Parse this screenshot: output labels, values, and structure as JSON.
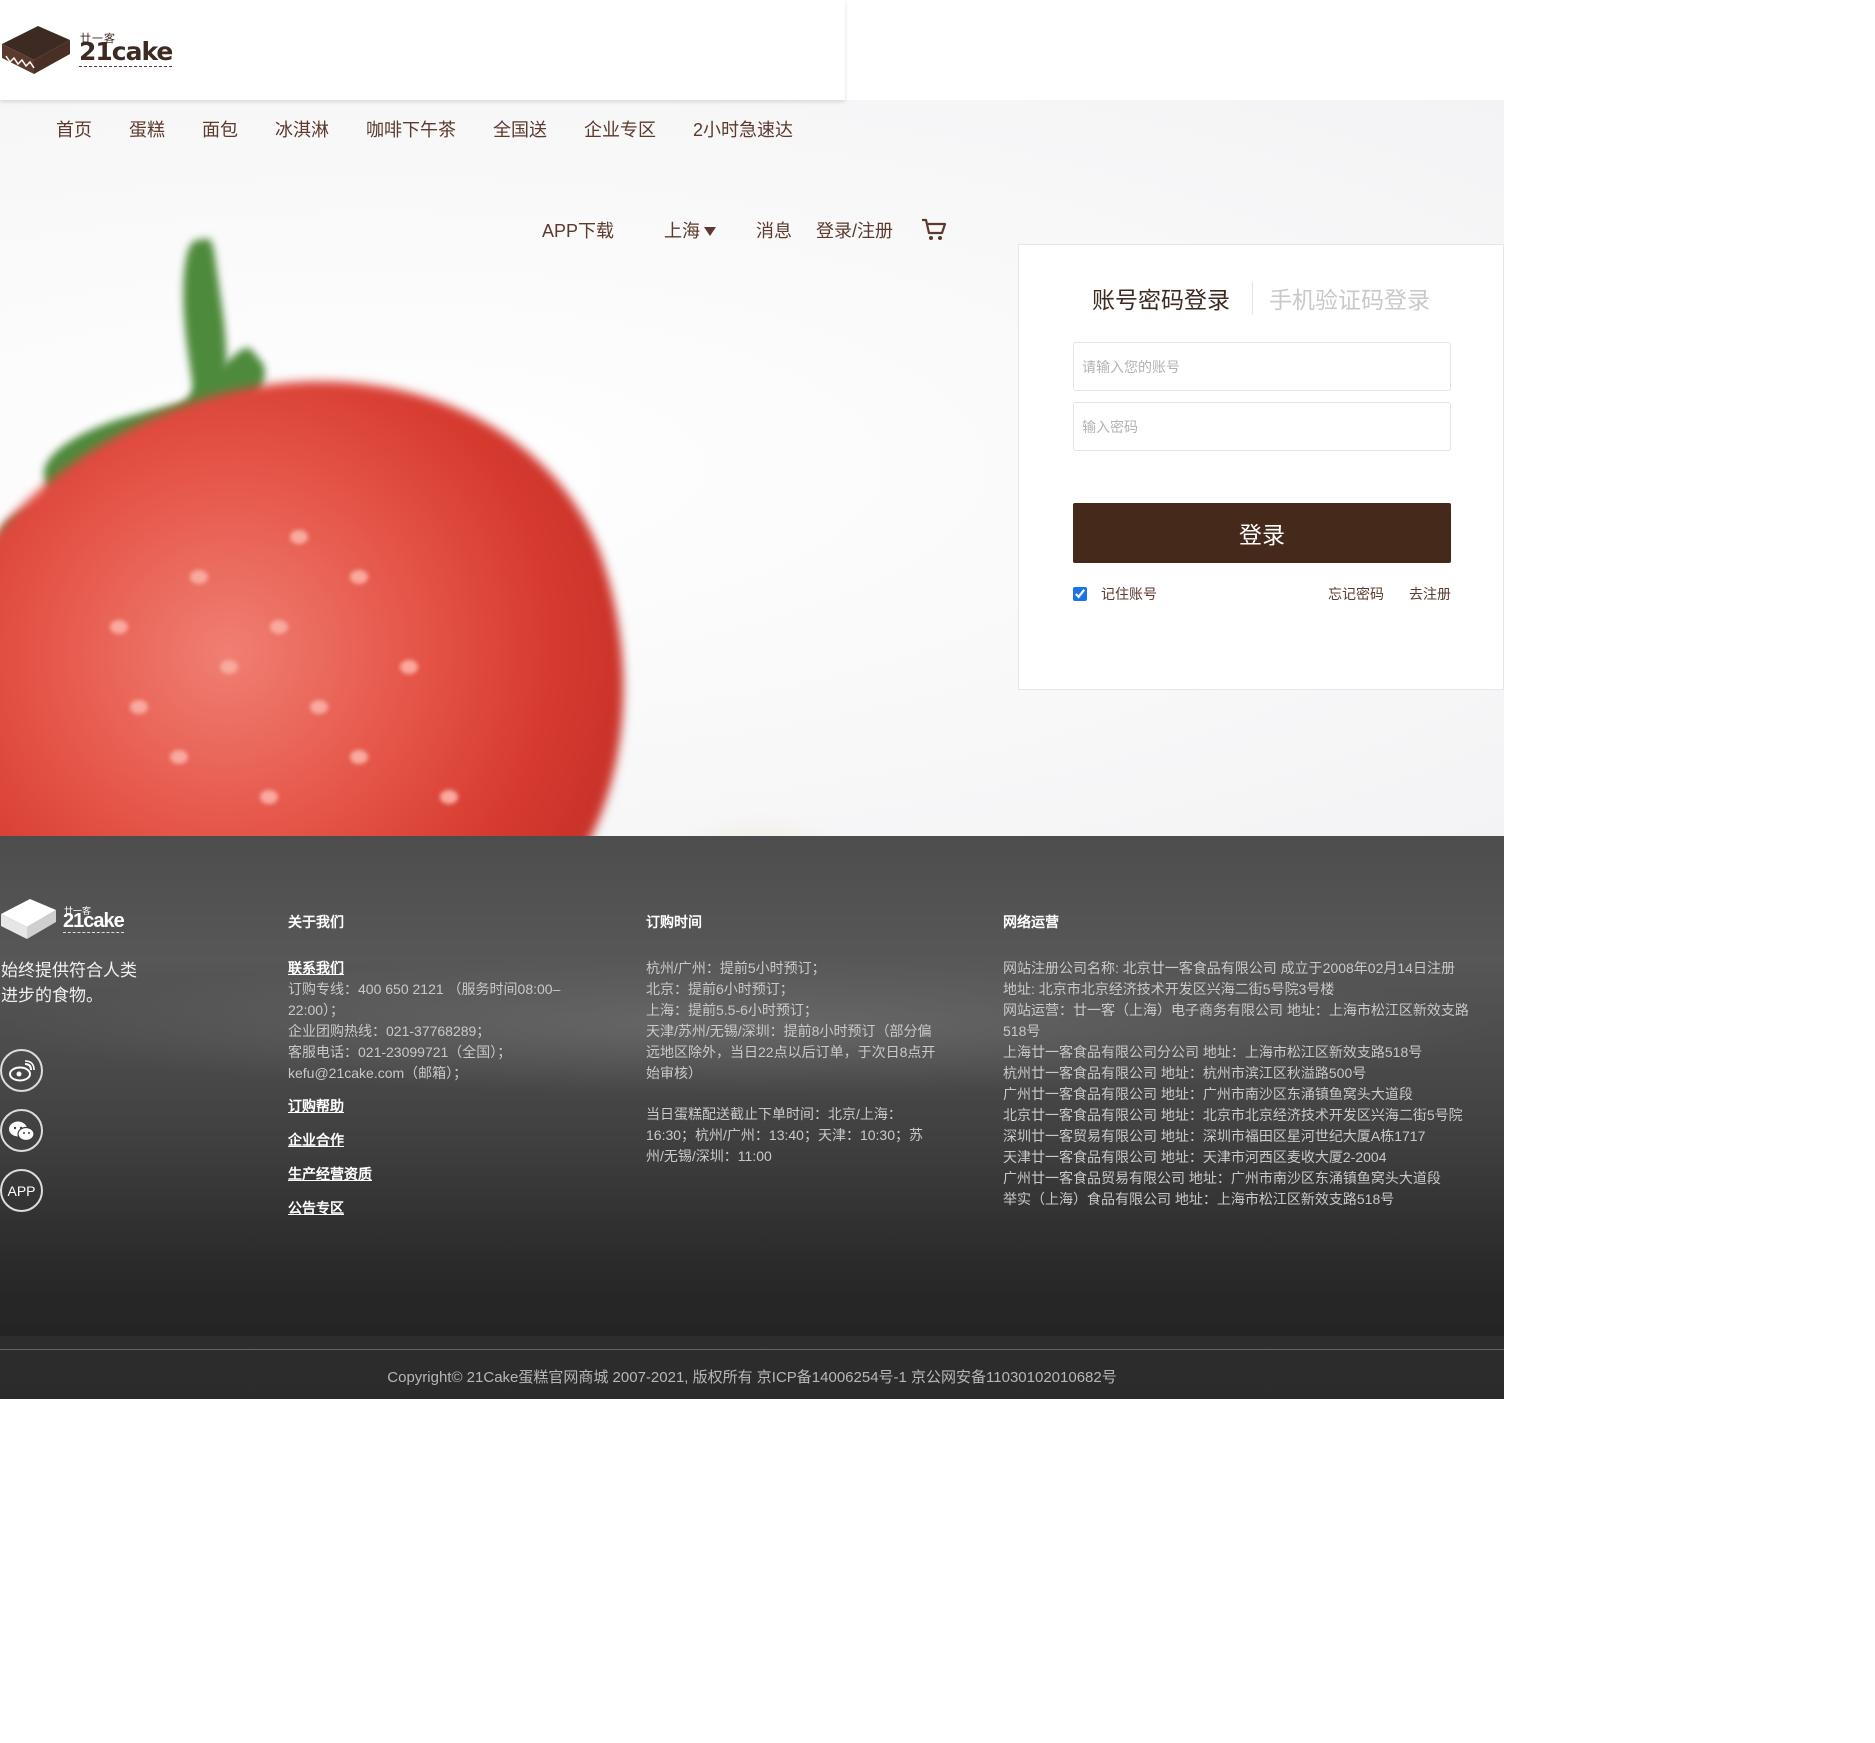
{
  "brand": {
    "cn": "廿一客",
    "en": "21cake"
  },
  "main_nav": [
    "首页",
    "蛋糕",
    "面包",
    "冰淇淋",
    "咖啡下午茶",
    "全国送",
    "企业专区",
    "2小时急速达"
  ],
  "util_nav": {
    "app": "APP下载",
    "city": "上海",
    "messages": "消息",
    "login_register": "登录/注册"
  },
  "login": {
    "tab_password": "账号密码登录",
    "tab_sms": "手机验证码登录",
    "account_placeholder": "请输入您的账号",
    "password_placeholder": "输入密码",
    "submit": "登录",
    "remember": "记住账号",
    "forgot": "忘记密码",
    "register": "去注册"
  },
  "footer": {
    "slogan": "始终提供符合人类进步的食物。",
    "app_label": "APP",
    "about": {
      "title": "关于我们",
      "contact_title": "联系我们",
      "contact_lines": [
        "订购专线：400 650 2121 （服务时间08:00–22:00）；",
        "企业团购热线：021-37768289；",
        "客服电话：021-23099721（全国）；",
        "kefu@21cake.com（邮箱）；"
      ],
      "links": [
        "订购帮助",
        "企业合作",
        "生产经营资质",
        "公告专区"
      ]
    },
    "order_time": {
      "title": "订购时间",
      "lines": [
        "杭州/广州：提前5小时预订；",
        "北京：提前6小时预订；",
        "上海：提前5.5-6小时预订；",
        "天津/苏州/无锡/深圳：提前8小时预订（部分偏远地区除外，当日22点以后订单，于次日8点开始审核）"
      ],
      "cutoff": "当日蛋糕配送截止下单时间：北京/上海：16:30；杭州/广州：13:40；天津：10:30；苏州/无锡/深圳：11:00"
    },
    "network": {
      "title": "网络运营",
      "lines": [
        "网站注册公司名称: 北京廿一客食品有限公司 成立于2008年02月14日注册",
        "地址: 北京市北京经济技术开发区兴海二街5号院3号楼",
        "网站运营：廿一客（上海）电子商务有限公司 地址：上海市松江区新效支路",
        "518号",
        "上海廿一客食品有限公司分公司 地址：上海市松江区新效支路518号",
        "杭州廿一客食品有限公司 地址：杭州市滨江区秋溢路500号",
        "广州廿一客食品有限公司 地址：广州市南沙区东涌镇鱼窝头大道段",
        "北京廿一客食品有限公司 地址：北京市北京经济技术开发区兴海二街5号院",
        "深圳廿一客贸易有限公司 地址：深圳市福田区星河世纪大厦A栋1717",
        "天津廿一客食品有限公司 地址：天津市河西区麦收大厦2-2004",
        "广州廿一客食品贸易有限公司 地址：广州市南沙区东涌镇鱼窝头大道段",
        "举实（上海）食品有限公司 地址：上海市松江区新效支路518号"
      ]
    },
    "copyright": "Copyright© 21Cake蛋糕官网商城 2007-2021, 版权所有 京ICP备14006254号-1 京公网安备11030102010682号"
  },
  "colors": {
    "brand_brown": "#45291b",
    "text_brown": "#5c3a2e",
    "checkbox_blue": "#1a73e8"
  },
  "icons": [
    "cake-logo-icon",
    "caret-down-icon",
    "cart-icon",
    "weibo-icon",
    "wechat-icon"
  ]
}
